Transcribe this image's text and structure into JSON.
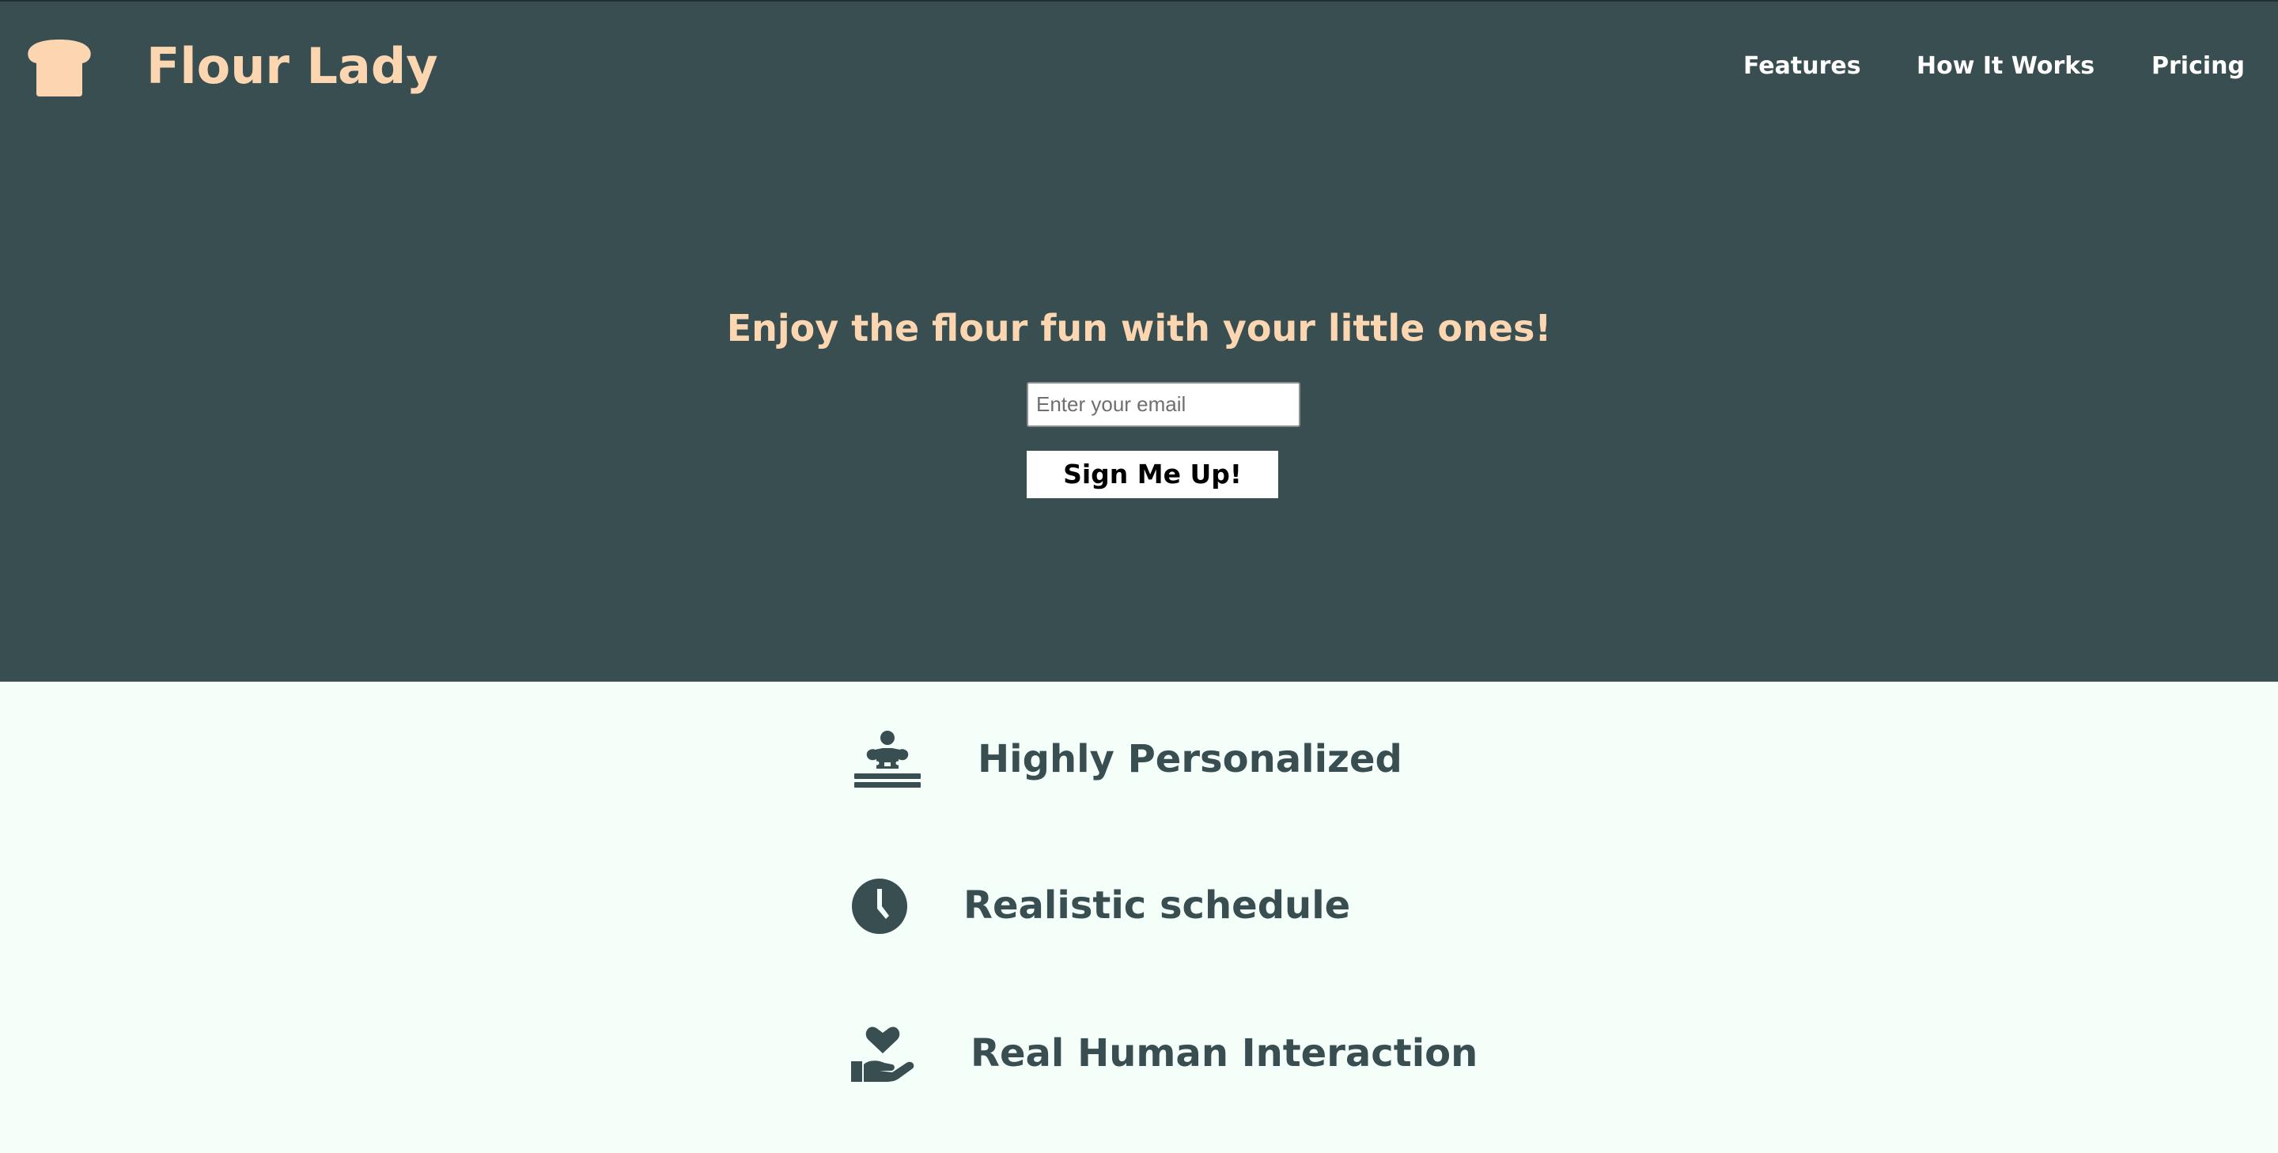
{
  "header": {
    "brand": "Flour Lady",
    "logo_icon": "bread-icon",
    "nav": [
      {
        "label": "Features"
      },
      {
        "label": "How It Works"
      },
      {
        "label": "Pricing"
      }
    ]
  },
  "hero": {
    "headline": "Enjoy the flour fun with your little ones!",
    "email_placeholder": "Enter your email",
    "email_value": "",
    "signup_label": "Sign Me Up!"
  },
  "features": [
    {
      "icon": "chef-icon",
      "title": "Highly Personalized"
    },
    {
      "icon": "clock-icon",
      "title": "Realistic schedule"
    },
    {
      "icon": "hand-holding-heart-icon",
      "title": "Real Human Interaction"
    }
  ],
  "colors": {
    "hero_background": "#384e51",
    "accent": "#fcd6b1",
    "page_background": "#f5fffa",
    "feature_text": "#384e51",
    "nav_text": "#ffffff"
  }
}
